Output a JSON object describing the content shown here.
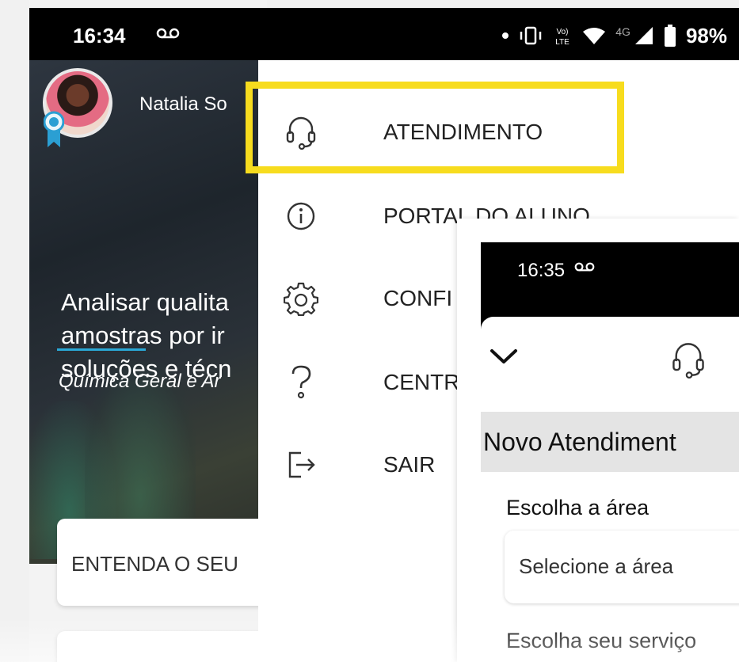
{
  "status_bar": {
    "time": "16:34",
    "voicemail_icon": "voicemail-icon",
    "icons": [
      "dot-icon",
      "vibrate-icon",
      "volte-icon",
      "wifi-icon",
      "4g-icon",
      "signal-icon",
      "battery-icon"
    ],
    "network_label": "4G",
    "volte_label": "Vo) LTE",
    "battery": "98%"
  },
  "app": {
    "user_name": "Natalia So",
    "hero_title_lines": [
      "Analisar qualita",
      "amostras por ir",
      "soluções e técn"
    ],
    "hero_subtitle": "Química Geral e Ar",
    "card_label": "ENTENDA O SEU",
    "accent_color": "#2aa8d6"
  },
  "drawer": {
    "items": [
      {
        "label": "ATENDIMENTO",
        "icon": "headset-icon"
      },
      {
        "label": "PORTAL DO ALUNO",
        "icon": "info-icon"
      },
      {
        "label": "CONFI",
        "icon": "gear-icon"
      },
      {
        "label": "CENTR",
        "icon": "question-icon"
      },
      {
        "label": "SAIR",
        "icon": "logout-icon"
      }
    ],
    "highlight_color": "#f7dc1e"
  },
  "inset": {
    "status_time": "16:35",
    "title": "Novo Atendiment",
    "area_label": "Escolha a área",
    "area_placeholder": "Selecione a área",
    "service_label": "Escolha seu serviço"
  }
}
